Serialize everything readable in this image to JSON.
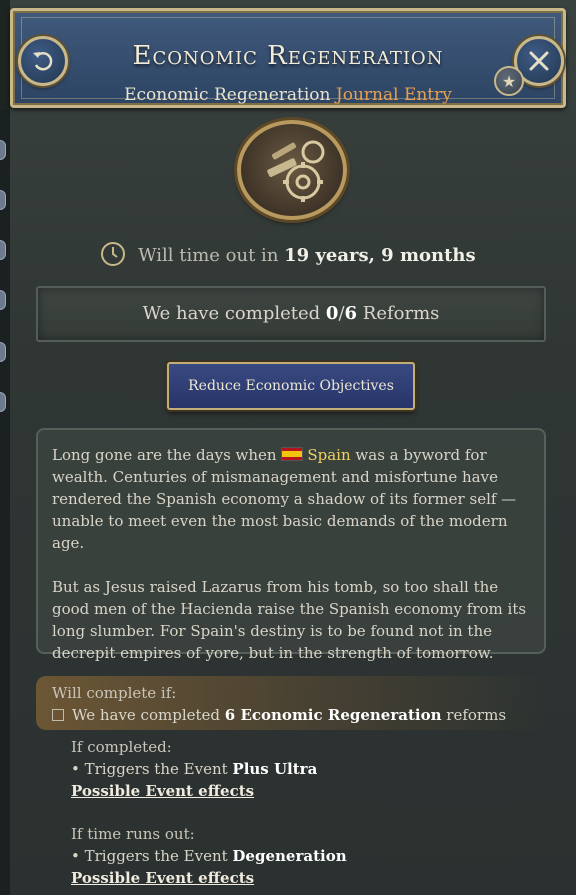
{
  "header": {
    "title": "Economic Regeneration",
    "subtitle_main": "Economic Regeneration",
    "subtitle_accent": "Journal Entry"
  },
  "timeout": {
    "prefix": "Will time out in",
    "value": "19 years, 9 months"
  },
  "progress": {
    "prefix": "We have completed",
    "completed": "0",
    "separator": "/",
    "total": "6",
    "suffix": "Reforms"
  },
  "action_button": {
    "label": "Reduce Economic Objectives"
  },
  "description": {
    "p1_before": "Long gone are the days when",
    "country": "Spain",
    "p1_after": "was a byword for wealth. Centuries of mismanagement and misfortune have rendered the Spanish economy a shadow of its former self — unable to meet even the most basic demands of the modern age.",
    "p2": "But as Jesus raised Lazarus from his tomb, so too shall the good men of the Hacienda raise the Spanish economy from its long slumber. For Spain's destiny is to be found not in the decrepit empires of yore, but in the strength of tomorrow."
  },
  "conditions": {
    "label": "Will complete if:",
    "item_prefix": "We have completed",
    "item_bold": "6 Economic Regeneration",
    "item_suffix": "reforms"
  },
  "outcomes": {
    "completed_head": "If completed:",
    "completed_prefix": "• Triggers the Event",
    "completed_event": "Plus Ultra",
    "completed_link": "Possible Event effects",
    "timeout_head": "If time runs out:",
    "timeout_prefix": "• Triggers the Event",
    "timeout_event": "Degeneration",
    "timeout_link": "Possible Event effects"
  },
  "icons": {
    "back": "back-arrow-icon",
    "close": "close-icon",
    "favorite": "star-icon",
    "emblem": "gears-emblem-icon",
    "clock": "clock-icon",
    "flag": "spain-flag-icon"
  }
}
